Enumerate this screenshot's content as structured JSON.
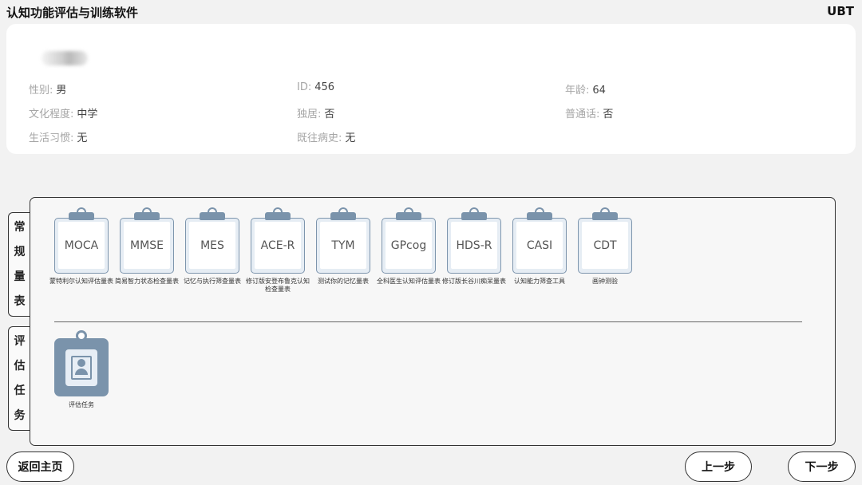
{
  "header": {
    "app_title": "认知功能评估与训练软件",
    "brand": "UBT"
  },
  "patient": {
    "gender_label": "性别:",
    "gender_value": "男",
    "id_label": "ID:",
    "id_value": "456",
    "age_label": "年龄:",
    "age_value": "64",
    "education_label": "文化程度:",
    "education_value": "中学",
    "living_alone_label": "独居:",
    "living_alone_value": "否",
    "mandarin_label": "普通话:",
    "mandarin_value": "否",
    "habits_label": "生活习惯:",
    "habits_value": "无",
    "history_label": "既往病史:",
    "history_value": "无"
  },
  "tabs": {
    "regular": [
      "常",
      "规",
      "量",
      "表"
    ],
    "task": [
      "评",
      "估",
      "任",
      "务"
    ]
  },
  "scales": [
    {
      "name": "MOCA",
      "desc": "蒙特利尔认知评估量表"
    },
    {
      "name": "MMSE",
      "desc": "简易智力状态检查量表"
    },
    {
      "name": "MES",
      "desc": "记忆与执行筛查量表"
    },
    {
      "name": "ACE-R",
      "desc": "修订版安登布鲁克认知检查量表"
    },
    {
      "name": "TYM",
      "desc": "测试你的记忆量表"
    },
    {
      "name": "GPcog",
      "desc": "全科医生认知评估量表"
    },
    {
      "name": "HDS-R",
      "desc": "修订版长谷川痴呆量表"
    },
    {
      "name": "CASI",
      "desc": "认知能力筛查工具"
    },
    {
      "name": "CDT",
      "desc": "画钟测验"
    }
  ],
  "task": {
    "label": "评估任务"
  },
  "footer": {
    "home_label": "返回主页",
    "prev_label": "上一步",
    "next_label": "下一步"
  }
}
